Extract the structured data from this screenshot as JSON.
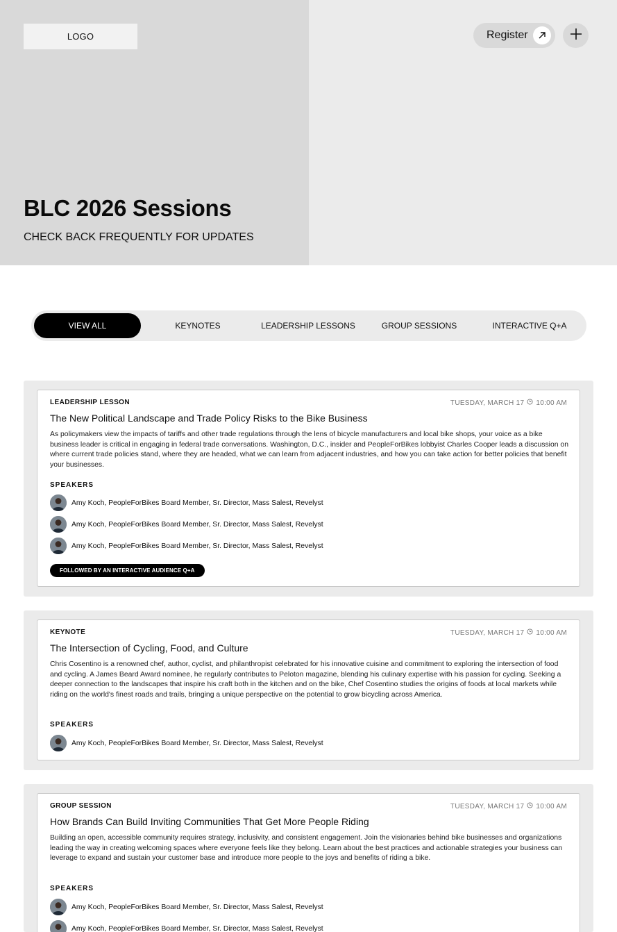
{
  "header": {
    "logo": "LOGO",
    "register_label": "Register",
    "title": "BLC 2026 Sessions",
    "subtitle": "CHECK BACK FREQUENTLY FOR UPDATES"
  },
  "tabs": [
    {
      "label": "VIEW ALL",
      "active": true
    },
    {
      "label": "KEYNOTES",
      "active": false
    },
    {
      "label": "LEADERSHIP LESSONS",
      "active": false
    },
    {
      "label": "GROUP SESSIONS",
      "active": false
    },
    {
      "label": "INTERACTIVE Q+A",
      "active": false
    }
  ],
  "sessions": [
    {
      "type": "LEADERSHIP LESSON",
      "date": "TUESDAY, MARCH 17",
      "time": "10:00 AM",
      "title": "The New Political Landscape and Trade Policy Risks to the Bike Business",
      "description": "As policymakers view the impacts of tariffs and other trade regulations through the lens of bicycle manufacturers and local bike shops, your voice as a bike business leader is critical in engaging in federal trade conversations. Washington, D.C., insider and PeopleForBikes lobbyist Charles Cooper leads a discussion on where current trade policies stand, where they are headed, what we can learn from adjacent industries, and how you can take action for better policies that benefit your businesses.",
      "speakers_label": "SPEAKERS",
      "speakers": [
        "Amy Koch, PeopleForBikes Board Member, Sr. Director, Mass Salest, Revelyst",
        "Amy Koch, PeopleForBikes Board Member, Sr. Director, Mass Salest, Revelyst",
        "Amy Koch, PeopleForBikes Board Member, Sr. Director, Mass Salest, Revelyst"
      ],
      "badge": "FOLLOWED BY AN INTERACTIVE AUDIENCE Q+A"
    },
    {
      "type": "KEYNOTE",
      "date": "TUESDAY, MARCH 17",
      "time": "10:00 AM",
      "title": "The Intersection of Cycling, Food, and Culture",
      "description": "Chris Cosentino is a renowned chef, author, cyclist, and philanthropist celebrated for his innovative cuisine and commitment to exploring the intersection of food and cycling. A James Beard Award nominee, he regularly contributes to Peloton magazine, blending his culinary expertise with his passion for cycling. Seeking a deeper connection to the landscapes that inspire his craft both in the kitchen and on the bike, Chef Cosentino studies the origins of foods at local markets while riding on the world's finest roads and trails, bringing a unique perspective on the potential to grow bicycling across America.",
      "speakers_label": "SPEAKERS",
      "speakers": [
        "Amy Koch, PeopleForBikes Board Member, Sr. Director, Mass Salest, Revelyst"
      ]
    },
    {
      "type": "GROUP SESSION",
      "date": "TUESDAY, MARCH 17",
      "time": "10:00 AM",
      "title": "How Brands Can Build Inviting Communities That Get More People Riding",
      "description": "Building an open, accessible community requires strategy, inclusivity, and consistent engagement. Join the visionaries behind bike businesses and organizations leading the way in creating welcoming spaces where everyone feels like they belong. Learn about the best practices and actionable strategies your business can leverage to expand and sustain your customer base and introduce more people to the joys and benefits of riding a bike.",
      "speakers_label": "SPEAKERS",
      "speakers": [
        "Amy Koch, PeopleForBikes Board Member, Sr. Director, Mass Salest, Revelyst",
        "Amy Koch, PeopleForBikes Board Member, Sr. Director, Mass Salest, Revelyst"
      ]
    }
  ],
  "icons": {
    "register": "arrow-up-right-icon",
    "plus": "plus-icon",
    "clock": "clock-icon"
  }
}
